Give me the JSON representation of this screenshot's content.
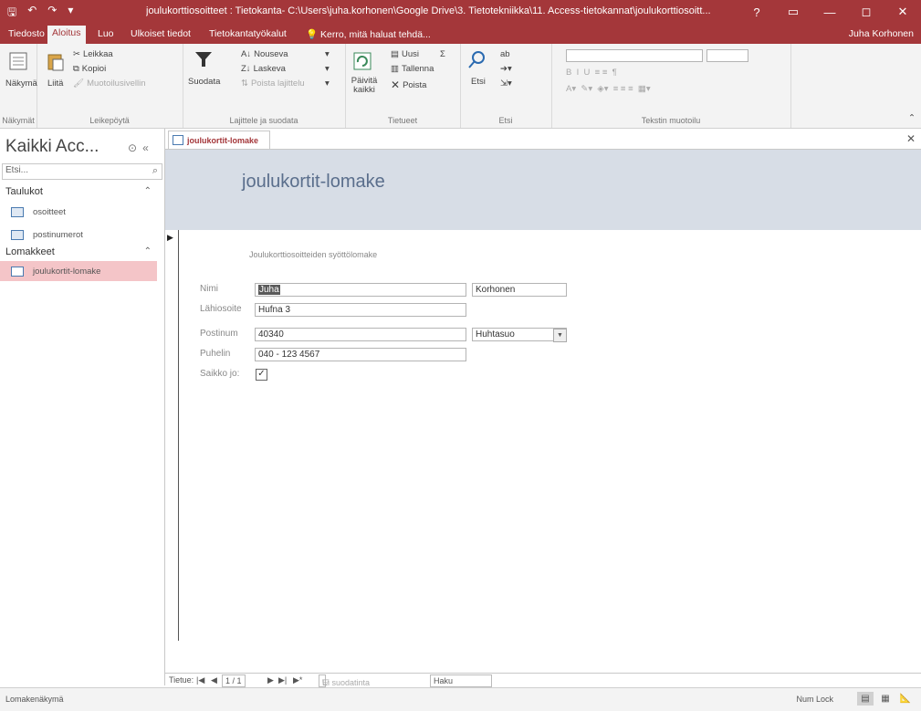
{
  "window": {
    "title": "joulukorttiosoitteet : Tietokanta- C:\\Users\\juha.korhonen\\Google Drive\\3. Tietotekniikka\\11. Access-tietokannat\\joulukorttiosoitt...",
    "help_glyph": "?",
    "minimize_glyph": "—",
    "restore_glyph": "◻",
    "close_glyph": "✕"
  },
  "tabs": [
    "Tiedosto",
    "Aloitus",
    "Luo",
    "Ulkoiset tiedot",
    "Tietokantatyökalut"
  ],
  "tell_me": "Kerro, mitä haluat tehdä...",
  "user": "Juha Korhonen",
  "ribbon": {
    "views": {
      "label": "Näkymä",
      "group": "Näkymät"
    },
    "clipboard": {
      "paste": "Liitä",
      "cut": "Leikkaa",
      "copy": "Kopioi",
      "format_painter": "Muotoilusivellin",
      "group": "Leikepöytä"
    },
    "sort": {
      "filter": "Suodata",
      "ascending": "Nouseva",
      "descending": "Laskeva",
      "remove_sort": "Poista lajittelu",
      "group": "Lajittele ja suodata"
    },
    "records": {
      "refresh": "Päivitä kaikki",
      "new": "Uusi",
      "save": "Tallenna",
      "delete": "Poista",
      "group": "Tietueet"
    },
    "find": {
      "find": "Etsi",
      "group": "Etsi"
    },
    "text": {
      "group": "Tekstin muotoilu"
    }
  },
  "nav": {
    "title": "Kaikki Acc...",
    "search_placeholder": "Etsi...",
    "sections": [
      {
        "label": "Taulukot",
        "items": [
          "osoitteet",
          "postinumerot"
        ]
      },
      {
        "label": "Lomakkeet",
        "items": [
          "joulukortit-lomake"
        ]
      }
    ]
  },
  "doc_tab": "joulukortit-lomake",
  "form": {
    "title": "joulukortit-lomake",
    "subtitle": "Joulukorttiosoitteiden syöttölomake",
    "fields": {
      "nimi_label": "Nimi",
      "firstname": "Juha",
      "lastname": "Korhonen",
      "address_label": "Lähiosoite",
      "address": "Hufna 3",
      "zip_label": "Postinum",
      "zip": "40340",
      "city": "Huhtasuo",
      "phone_label": "Puhelin",
      "phone": "040 - 123 4567",
      "sent_label": "Saikko jo:",
      "sent": true
    }
  },
  "record_nav": {
    "label": "Tietue:",
    "position": "1 / 1",
    "filter": "Ei suodatinta",
    "search": "Haku"
  },
  "status": {
    "left": "Lomakenäkymä",
    "numlock": "Num Lock"
  },
  "colors": {
    "accent": "#a4373a",
    "form_header": "#d7dde6",
    "selected_nav": "#f4c5c8"
  }
}
